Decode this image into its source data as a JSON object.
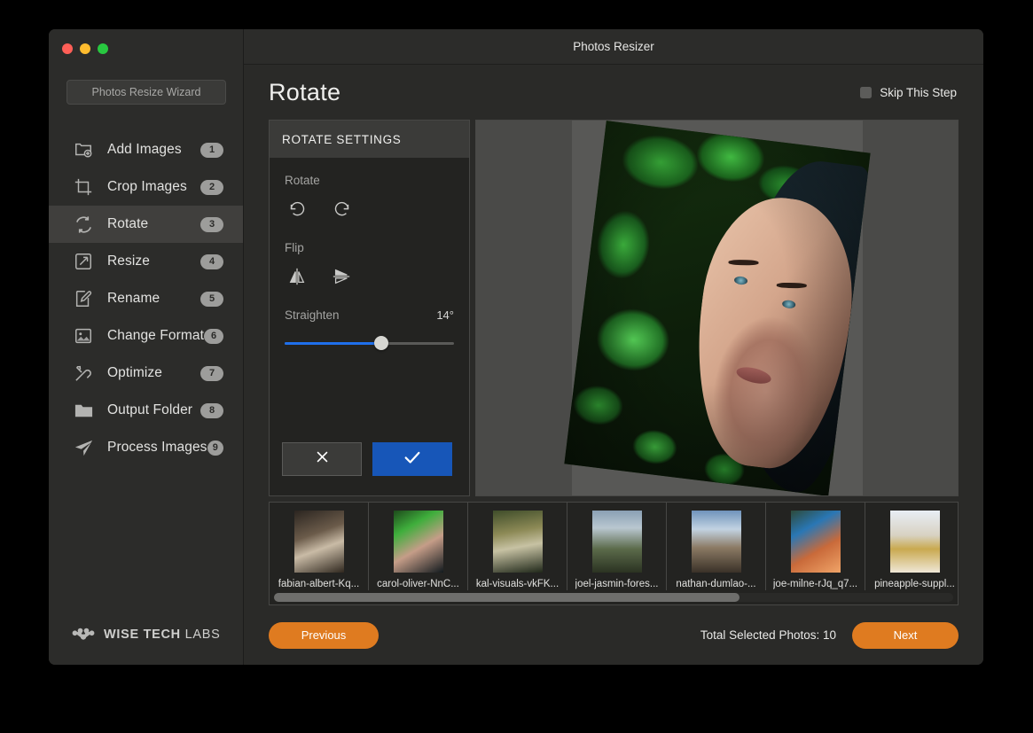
{
  "window": {
    "title": "Photos Resizer",
    "traffic_lights": [
      "close",
      "minimize",
      "maximize"
    ]
  },
  "sidebar": {
    "wizard_button": "Photos Resize Wizard",
    "items": [
      {
        "label": "Add Images",
        "badge": "1",
        "icon": "add-images-icon",
        "active": false
      },
      {
        "label": "Crop Images",
        "badge": "2",
        "icon": "crop-icon",
        "active": false
      },
      {
        "label": "Rotate",
        "badge": "3",
        "icon": "rotate-icon",
        "active": true
      },
      {
        "label": "Resize",
        "badge": "4",
        "icon": "resize-icon",
        "active": false
      },
      {
        "label": "Rename",
        "badge": "5",
        "icon": "rename-icon",
        "active": false
      },
      {
        "label": "Change Format",
        "badge": "6",
        "icon": "image-format-icon",
        "active": false
      },
      {
        "label": "Optimize",
        "badge": "7",
        "icon": "tools-icon",
        "active": false
      },
      {
        "label": "Output Folder",
        "badge": "8",
        "icon": "folder-icon",
        "active": false
      },
      {
        "label": "Process Images",
        "badge": "9",
        "icon": "paper-plane-icon",
        "active": false
      }
    ],
    "brand": {
      "bold": "WISE TECH",
      "light": "LABS",
      "icon": "wise-tech-labs-logo-icon"
    }
  },
  "header": {
    "page_title": "Rotate",
    "skip_label": "Skip This Step",
    "skip_checked": false
  },
  "settings": {
    "panel_title": "ROTATE SETTINGS",
    "rotate_label": "Rotate",
    "rotate_ccw_icon": "rotate-counterclockwise-icon",
    "rotate_cw_icon": "rotate-clockwise-icon",
    "flip_label": "Flip",
    "flip_horizontal_icon": "flip-horizontal-icon",
    "flip_vertical_icon": "flip-vertical-icon",
    "straighten_label": "Straighten",
    "straighten_value": "14°",
    "straighten_percent": 57,
    "cancel_icon": "close-icon",
    "confirm_icon": "check-icon"
  },
  "preview": {
    "image_name": "carol-oliver-NnC...",
    "rotation_degrees": 7
  },
  "thumbnails": [
    {
      "caption": "fabian-albert-Kq...",
      "art": "a1"
    },
    {
      "caption": "carol-oliver-NnC...",
      "art": "a2"
    },
    {
      "caption": "kal-visuals-vkFK...",
      "art": "a3"
    },
    {
      "caption": "joel-jasmin-fores...",
      "art": "a4"
    },
    {
      "caption": "nathan-dumlao-...",
      "art": "a5"
    },
    {
      "caption": "joe-milne-rJq_q7...",
      "art": "a6"
    },
    {
      "caption": "pineapple-suppl...",
      "art": "a7"
    }
  ],
  "scroll": {
    "thumb_percent": 68.5
  },
  "footer": {
    "previous_label": "Previous",
    "total_label": "Total Selected Photos: 10",
    "next_label": "Next"
  },
  "colors": {
    "accent_orange": "#df7b20",
    "accent_blue": "#1f6feb",
    "confirm_blue": "#1756b8",
    "window_bg": "#2a2a28",
    "sidebar_bg": "#2c2c2a"
  }
}
